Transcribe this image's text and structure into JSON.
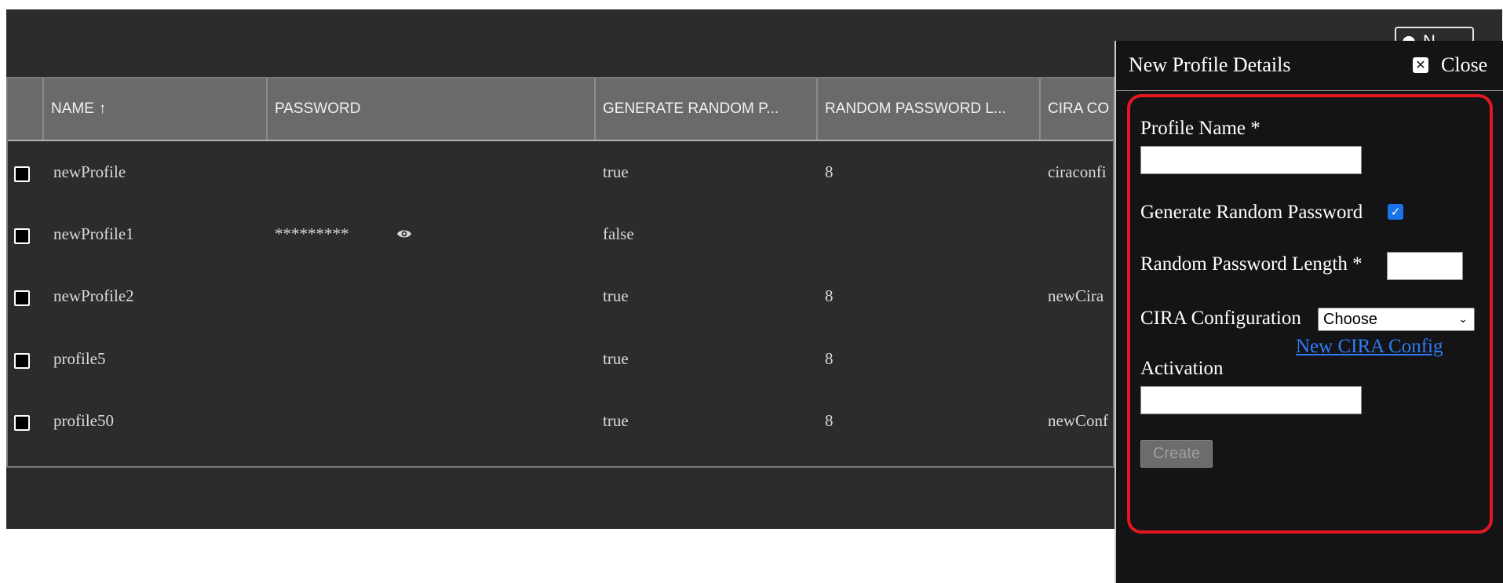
{
  "toolbar": {
    "new_label": "N"
  },
  "table": {
    "columns": [
      "NAME",
      "PASSWORD",
      "GENERATE RANDOM P...",
      "RANDOM PASSWORD L...",
      "CIRA CO"
    ],
    "sort_indicator": "↑",
    "rows": [
      {
        "name": "newProfile",
        "password": "",
        "generate": "true",
        "length": "8",
        "cira": "ciraconfi"
      },
      {
        "name": "newProfile1",
        "password": "*********",
        "generate": "false",
        "length": "",
        "cira": ""
      },
      {
        "name": "newProfile2",
        "password": "",
        "generate": "true",
        "length": "8",
        "cira": "newCira"
      },
      {
        "name": "profile5",
        "password": "",
        "generate": "true",
        "length": "8",
        "cira": ""
      },
      {
        "name": "profile50",
        "password": "",
        "generate": "true",
        "length": "8",
        "cira": "newConf"
      }
    ]
  },
  "panel": {
    "title": "New Profile Details",
    "close_label": "Close",
    "profile_name_label": "Profile Name *",
    "profile_name_value": "",
    "generate_label": "Generate Random Password",
    "generate_checked": true,
    "length_label": "Random Password Length *",
    "length_value": "",
    "cira_label": "CIRA Configuration",
    "cira_selected": "Choose",
    "new_cira_link": "New CIRA Config",
    "activation_label": "Activation",
    "activation_value": "",
    "create_label": "Create"
  },
  "colors": {
    "page_background": "#2d2b2c",
    "header_background": "#6a6a6a",
    "panel_background": "#141416",
    "highlight_border": "#e3171f",
    "link": "#2f7df6",
    "checkbox_accent": "#1a73e8"
  },
  "icons": [
    "checkbox-icon",
    "eye-icon",
    "close-icon",
    "chevron-down-icon",
    "check-icon"
  ]
}
